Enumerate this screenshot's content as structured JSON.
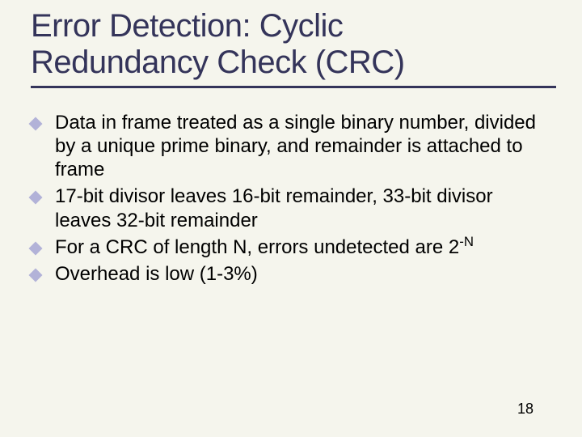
{
  "title_line1": "Error Detection: Cyclic",
  "title_line2": "Redundancy Check (CRC)",
  "bullets": [
    "Data in frame treated as a single binary number, divided by a unique prime binary, and remainder is attached to frame",
    "17-bit divisor leaves 16-bit remainder, 33-bit divisor leaves 32-bit remainder",
    "For a CRC of length N, errors undetected are 2",
    "Overhead is low (1-3%)"
  ],
  "sup_b3": "-N",
  "page_number": "18"
}
